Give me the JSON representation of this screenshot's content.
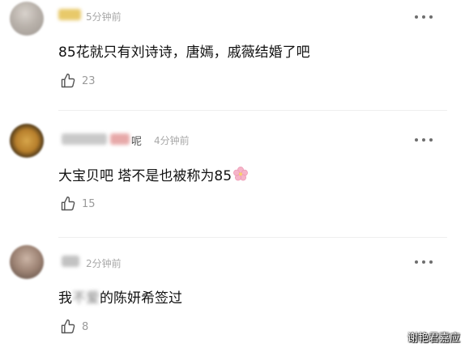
{
  "comments": [
    {
      "time": "5分钟前",
      "text": "85花就只有刘诗诗，唐嫣，戚薇结婚了吧",
      "likes": "23"
    },
    {
      "name_tail": "呢",
      "time": "4分钟前",
      "text": "大宝贝吧  塔不是也被称为85",
      "likes": "15"
    },
    {
      "time": "2分钟前",
      "text_before": "我",
      "text_blur": "不爱",
      "text_after": "的陈妍希签过",
      "likes": "8"
    }
  ],
  "icons": {
    "more": "more-dots-icon",
    "like": "thumbs-up-icon",
    "emoji": "cherry-blossom-icon"
  },
  "watermark": "谢艳君嘉应"
}
